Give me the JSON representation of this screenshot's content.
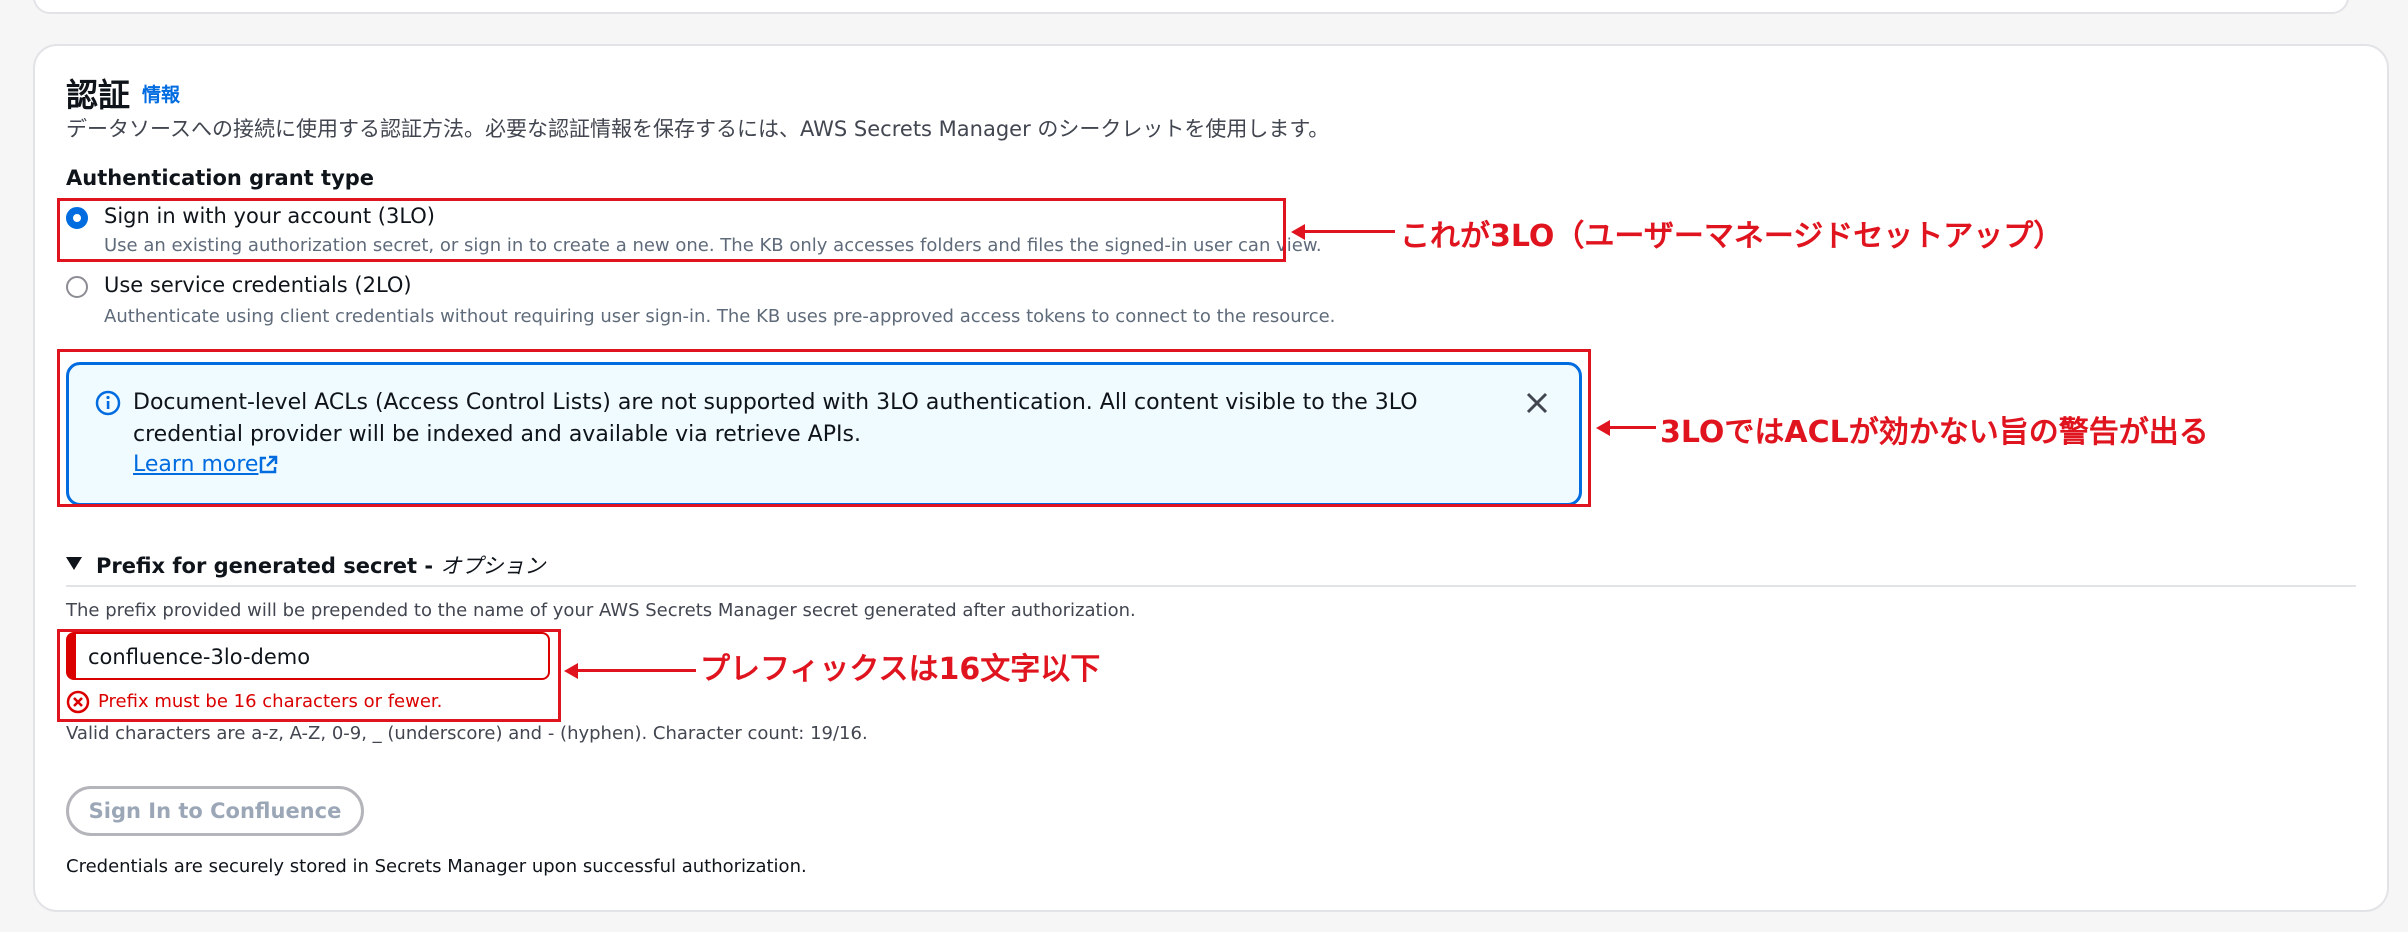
{
  "section": {
    "title": "認証",
    "info_link": "情報",
    "description": "データソースへの接続に使用する認証方法。必要な認証情報を保存するには、AWS Secrets Manager のシークレットを使用します。"
  },
  "grant": {
    "label": "Authentication grant type",
    "options": [
      {
        "title": "Sign in with your account (3LO)",
        "description": "Use an existing authorization secret, or sign in to create a new one. The KB only accesses folders and files the signed-in user can view.",
        "selected": true
      },
      {
        "title": "Use service credentials (2LO)",
        "description": "Authenticate using client credentials without requiring user sign-in. The KB uses pre-approved access tokens to connect to the resource.",
        "selected": false
      }
    ]
  },
  "alert": {
    "text": "Document-level ACLs (Access Control Lists) are not supported with 3LO authentication. All content visible to the 3LO credential provider will be indexed and available via retrieve APIs.",
    "link": "Learn more"
  },
  "prefix": {
    "heading": "Prefix for generated secret -",
    "optional": "オプション",
    "description": "The prefix provided will be prepended to the name of your AWS Secrets Manager secret generated after authorization.",
    "value": "confluence-3lo-demo",
    "error": "Prefix must be 16 characters or fewer.",
    "constraint": "Valid characters are a-z, A-Z, 0-9, _ (underscore) and - (hyphen). Character count: 19/16."
  },
  "signin_button": "Sign In to Confluence",
  "footer_note": "Credentials are securely stored in Secrets Manager upon successful authorization.",
  "annotations": {
    "a1": "これが3LO（ユーザーマネージドセットアップ）",
    "a2": "3LOではACLが効かない旨の警告が出る",
    "a3": "プレフィックスは16文字以下"
  },
  "colors": {
    "accent": "#006ce0",
    "error": "#db0000",
    "annotation": "#e0141e"
  }
}
